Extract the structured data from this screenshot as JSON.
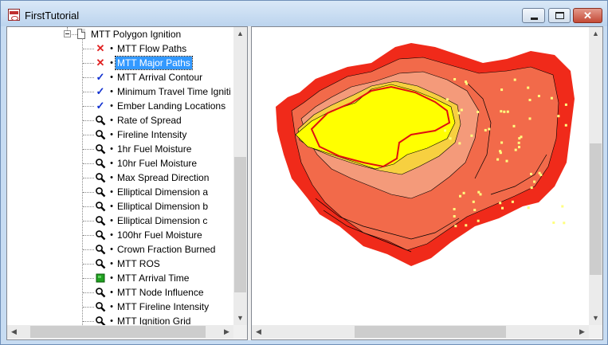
{
  "window": {
    "title": "FirstTutorial",
    "controls": {
      "minimize": "minimize",
      "maximize": "maximize",
      "close": "✕"
    }
  },
  "tree": {
    "parent": {
      "label": "MTT Polygon Ignition"
    },
    "items": [
      {
        "label": "MTT Flow Paths",
        "icon": "red-x-icon",
        "selected": false
      },
      {
        "label": "MTT Major Paths",
        "icon": "red-x-icon",
        "selected": true
      },
      {
        "label": "MTT Arrival Contour",
        "icon": "blue-check-icon",
        "selected": false
      },
      {
        "label": "Minimum Travel Time Igniti",
        "icon": "blue-check-icon",
        "selected": false
      },
      {
        "label": "Ember Landing Locations",
        "icon": "blue-check-icon",
        "selected": false
      },
      {
        "label": "Rate of Spread",
        "icon": "magnifier-icon",
        "selected": false
      },
      {
        "label": "Fireline Intensity",
        "icon": "magnifier-icon",
        "selected": false
      },
      {
        "label": "1hr Fuel Moisture",
        "icon": "magnifier-icon",
        "selected": false
      },
      {
        "label": "10hr Fuel Moisture",
        "icon": "magnifier-icon",
        "selected": false
      },
      {
        "label": "Max Spread Direction",
        "icon": "magnifier-icon",
        "selected": false
      },
      {
        "label": "Elliptical Dimension a",
        "icon": "magnifier-icon",
        "selected": false
      },
      {
        "label": "Elliptical Dimension b",
        "icon": "magnifier-icon",
        "selected": false
      },
      {
        "label": "Elliptical Dimension c",
        "icon": "magnifier-icon",
        "selected": false
      },
      {
        "label": "100hr Fuel Moisture",
        "icon": "magnifier-icon",
        "selected": false
      },
      {
        "label": "Crown Fraction Burned",
        "icon": "magnifier-icon",
        "selected": false
      },
      {
        "label": "MTT ROS",
        "icon": "magnifier-icon",
        "selected": false
      },
      {
        "label": "MTT Arrival Time",
        "icon": "green-square-icon",
        "selected": false
      },
      {
        "label": "MTT Node Influence",
        "icon": "magnifier-icon",
        "selected": false
      },
      {
        "label": "MTT Fireline Intensity",
        "icon": "magnifier-icon",
        "selected": false
      },
      {
        "label": "MTT Ignition Grid",
        "icon": "magnifier-icon",
        "selected": false
      }
    ]
  },
  "map": {
    "palette": {
      "outer": "#f02a1a",
      "mid": "#f26a4a",
      "inner": "#f49a7a",
      "core": "#ffff00",
      "contour": "#000000",
      "major_path": "#e01010",
      "ember": "#ffff80"
    }
  },
  "colors": {
    "selection": "#3399ff",
    "red_x": "#e02020",
    "blue_check": "#1030d0",
    "green_square": "#20a020"
  }
}
